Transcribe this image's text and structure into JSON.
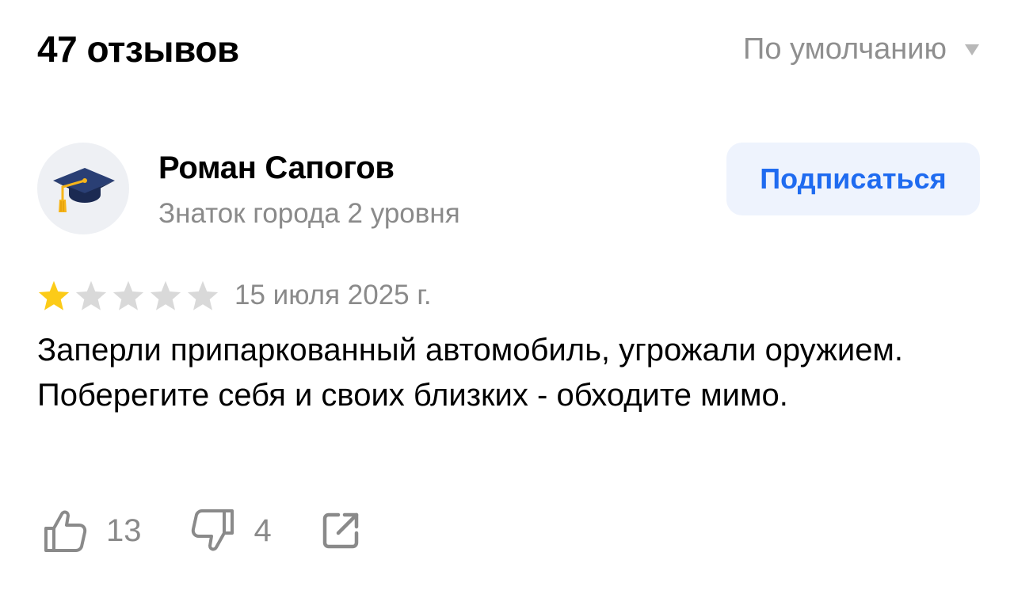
{
  "header": {
    "reviews_count": "47 отзывов",
    "sort_label": "По умолчанию",
    "sort_icon": "triangle-down-icon"
  },
  "author": {
    "name": "Роман Сапогов",
    "level": "Знаток города 2 уровня",
    "avatar_icon": "graduation-cap-icon",
    "subscribe_label": "Подписаться"
  },
  "review": {
    "rating": 1,
    "max_rating": 5,
    "date": "15 июля 2025 г.",
    "text": "Заперли припаркованный автомобиль, угрожали оружием. Поберегите себя и своих близких - обходите мимо."
  },
  "actions": {
    "likes": "13",
    "dislikes": "4",
    "like_icon": "thumbs-up-icon",
    "dislike_icon": "thumbs-down-icon",
    "share_icon": "share-icon"
  },
  "colors": {
    "accent": "#1f6bf0",
    "button_bg": "#eef3fd",
    "star_filled": "#fccb18",
    "star_empty": "#d9d9d9",
    "muted_text": "#8a8a8a"
  }
}
